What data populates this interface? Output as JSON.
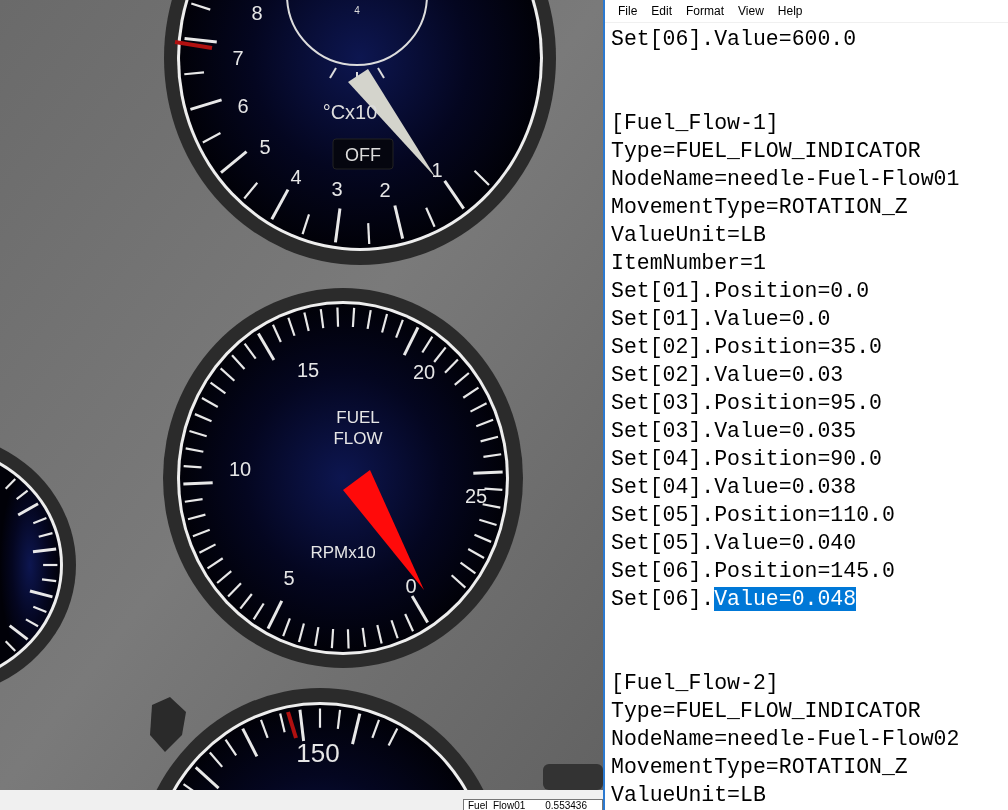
{
  "viewport": {
    "gauges": [
      {
        "kind": "temperature",
        "labels": [
          "8",
          "7",
          "6",
          "5",
          "4",
          "3",
          "2",
          "1"
        ],
        "unit": "°Cx10",
        "button": "OFF",
        "subdial_label": "4"
      },
      {
        "kind": "fuel_flow",
        "labels": [
          "15",
          "20",
          "10",
          "25",
          "5",
          "0"
        ],
        "title": [
          "FUEL",
          "FLOW"
        ],
        "unit": "RPMx10"
      },
      {
        "kind": "side"
      },
      {
        "kind": "airspeed",
        "labels": [
          "150"
        ]
      }
    ],
    "tooltip": {
      "name": "Fuel_Flow01",
      "value": "0.553436"
    }
  },
  "notepad": {
    "menu": [
      "File",
      "Edit",
      "Format",
      "View",
      "Help"
    ],
    "blocks": [
      {
        "lines": [
          {
            "text": "Set[06].Value=600.0"
          }
        ]
      },
      {
        "lines": [
          {
            "text": "[Fuel_Flow-1]"
          },
          {
            "text": "Type=FUEL_FLOW_INDICATOR"
          },
          {
            "text": "NodeName=needle-Fuel-Flow01"
          },
          {
            "text": "MovementType=ROTATION_Z"
          },
          {
            "text": "ValueUnit=LB"
          },
          {
            "text": "ItemNumber=1"
          },
          {
            "text": "Set[01].Position=0.0"
          },
          {
            "text": "Set[01].Value=0.0"
          },
          {
            "text": "Set[02].Position=35.0"
          },
          {
            "text": "Set[02].Value=0.03"
          },
          {
            "text": "Set[03].Position=95.0"
          },
          {
            "text": "Set[03].Value=0.035"
          },
          {
            "text": "Set[04].Position=90.0"
          },
          {
            "text": "Set[04].Value=0.038"
          },
          {
            "text": "Set[05].Position=110.0"
          },
          {
            "text": "Set[05].Value=0.040"
          },
          {
            "text": "Set[06].Position=145.0"
          },
          {
            "text": "Set[06].",
            "selection": "Value=0.048"
          }
        ]
      },
      {
        "lines": [
          {
            "text": "[Fuel_Flow-2]"
          },
          {
            "text": "Type=FUEL_FLOW_INDICATOR"
          },
          {
            "text": "NodeName=needle-Fuel-Flow02"
          },
          {
            "text": "MovementType=ROTATION_Z"
          },
          {
            "text": "ValueUnit=LB"
          }
        ]
      }
    ]
  }
}
